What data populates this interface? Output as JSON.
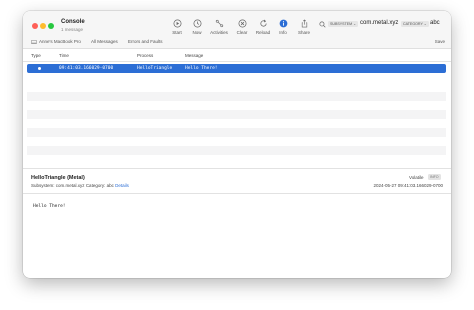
{
  "window": {
    "title": "Console",
    "subtitle": "1 message"
  },
  "toolbar": {
    "buttons": [
      {
        "label": "Start",
        "icon": "play-circle-icon"
      },
      {
        "label": "Now",
        "icon": "clock-arrow-icon"
      },
      {
        "label": "Activities",
        "icon": "activities-icon"
      },
      {
        "label": "Clear",
        "icon": "clear-circle-x-icon"
      },
      {
        "label": "Reload",
        "icon": "reload-icon"
      },
      {
        "label": "Info",
        "icon": "info-circle-icon"
      },
      {
        "label": "Share",
        "icon": "share-icon"
      }
    ],
    "info_active_color": "#2c6ed5"
  },
  "search": {
    "tokens": [
      {
        "key": "SUBSYSTEM ⌄",
        "value": "com.metal.xyz"
      },
      {
        "key": "CATEGORY ⌄",
        "value": "abc"
      }
    ]
  },
  "scope_bar": {
    "device": "Anne's MacBook Pro",
    "all_messages": "All Messages",
    "errors_faults": "Errors and Faults",
    "save": "Save"
  },
  "table": {
    "columns": [
      "Type",
      "Time",
      "Process",
      "Message"
    ],
    "rows": [
      {
        "time": "09:41:03.166029-0700",
        "process": "HelloTriangle",
        "message": "Hello There!"
      }
    ],
    "selection_color": "#2c6ed5"
  },
  "detail": {
    "title": "HelloTriangle (Metal)",
    "subsystem_label": "Subsystem:",
    "subsystem": "com.metal.xyz",
    "category_label": "Category:",
    "category": "abc",
    "details_link": "Details",
    "volatile": "Volatile",
    "badge": "INFO",
    "timestamp": "2024-05-27 09:41:03.166029-0700",
    "message": "Hello There!"
  }
}
